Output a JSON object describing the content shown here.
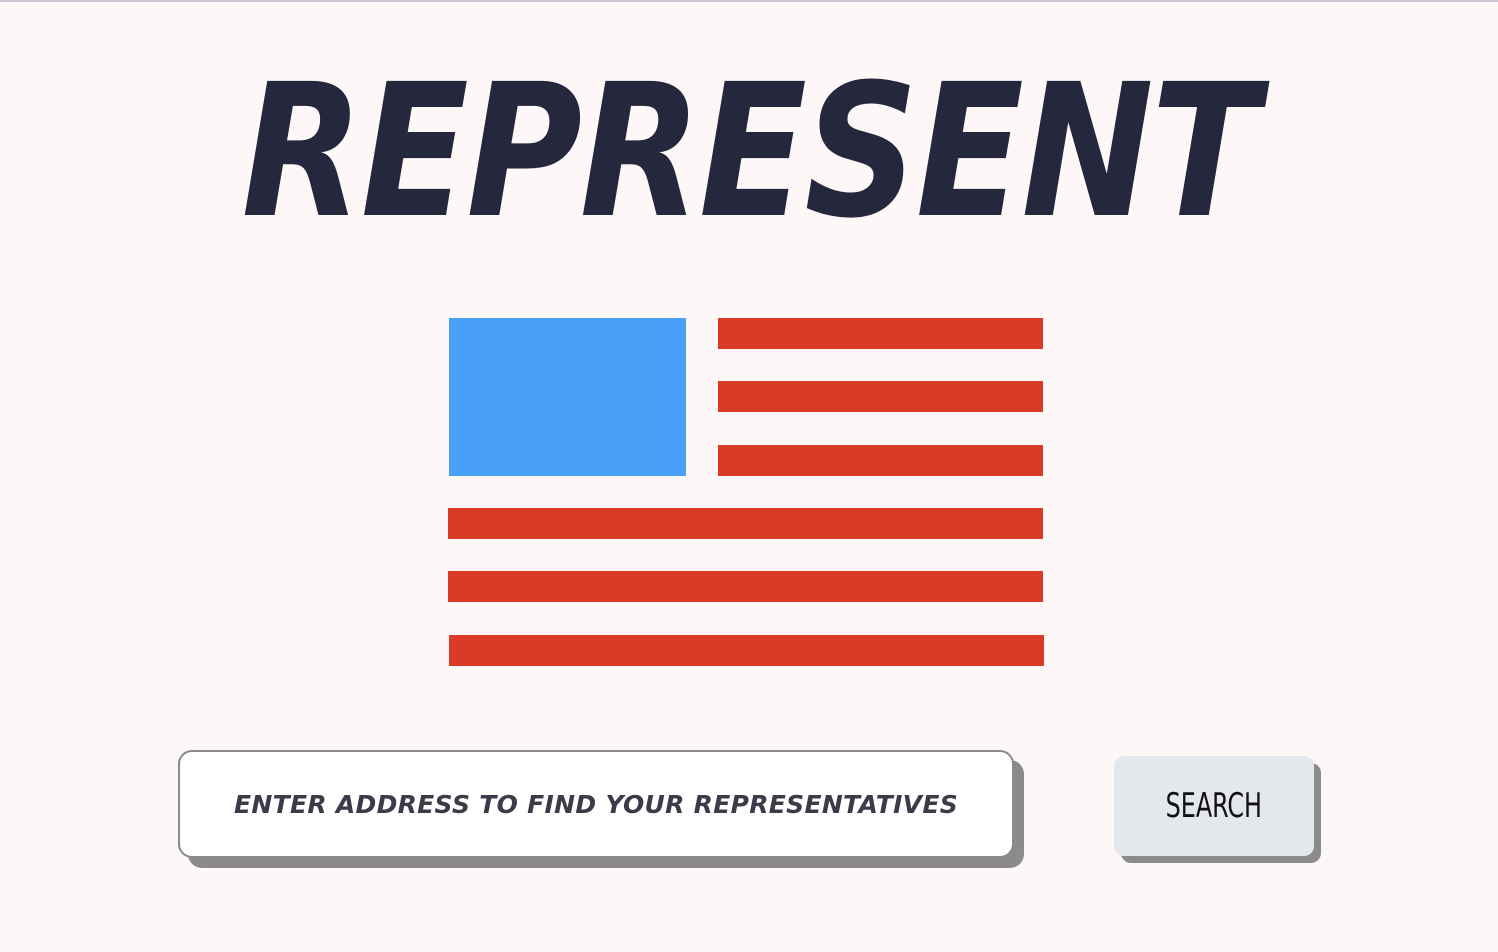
{
  "header": {
    "title": "REPRESENT"
  },
  "hero": {
    "icon": "american-flag-icon",
    "colors": {
      "canton": "#48a0f8",
      "stripe": "#da3a26"
    }
  },
  "search": {
    "placeholder": "ENTER ADDRESS TO FIND YOUR REPRESENTATIVES",
    "value": "",
    "button_label": "SEARCH"
  },
  "theme": {
    "background": "#fdf8f7",
    "title_color": "#25283d",
    "button_background": "#e4e7ec",
    "shadow": "#8b8b8b"
  }
}
